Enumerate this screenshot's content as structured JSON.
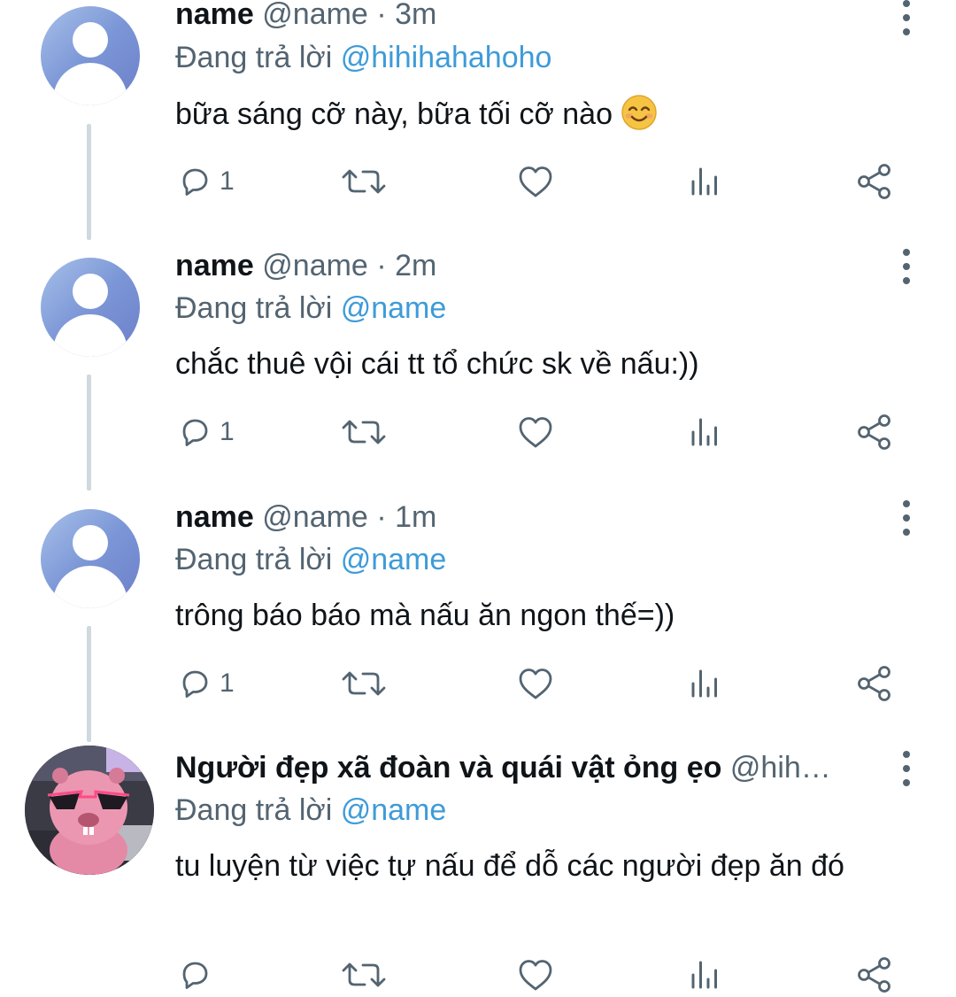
{
  "tweets": [
    {
      "name": "name",
      "handle": "@name",
      "dot": "·",
      "time": "3m",
      "reply_prefix": "Đang trả lời",
      "reply_to": "@hihihahahoho",
      "text": "bữa sáng cỡ này, bữa tối cỡ nào",
      "emoji": "smiling-face",
      "reply_count": "1"
    },
    {
      "name": "name",
      "handle": "@name",
      "dot": "·",
      "time": "2m",
      "reply_prefix": "Đang trả lời",
      "reply_to": "@name",
      "text": "chắc thuê vội cái tt tổ chức sk về nấu:))",
      "reply_count": "1"
    },
    {
      "name": "name",
      "handle": "@name",
      "dot": "·",
      "time": "1m",
      "reply_prefix": "Đang trả lời",
      "reply_to": "@name",
      "text": "trông báo báo mà nấu ăn ngon thế=))",
      "reply_count": "1"
    },
    {
      "name": "Người đẹp xã đoàn và quái vật ỏng ẹo",
      "handle": "@hih…",
      "reply_prefix": "Đang trả lời",
      "reply_to": "@name",
      "text": "tu luyện từ việc tự nấu để dỗ các người đẹp ăn đó",
      "reply_count": ""
    }
  ],
  "icons": {
    "reply": "reply-icon",
    "retweet": "retweet-icon",
    "like": "like-icon",
    "views": "views-icon",
    "share": "share-icon",
    "more": "more-options-icon"
  },
  "colors": {
    "mention": "#3e9bd8",
    "secondary_text": "#536471",
    "icon": "#536471",
    "thread_line": "#cfd9de"
  }
}
